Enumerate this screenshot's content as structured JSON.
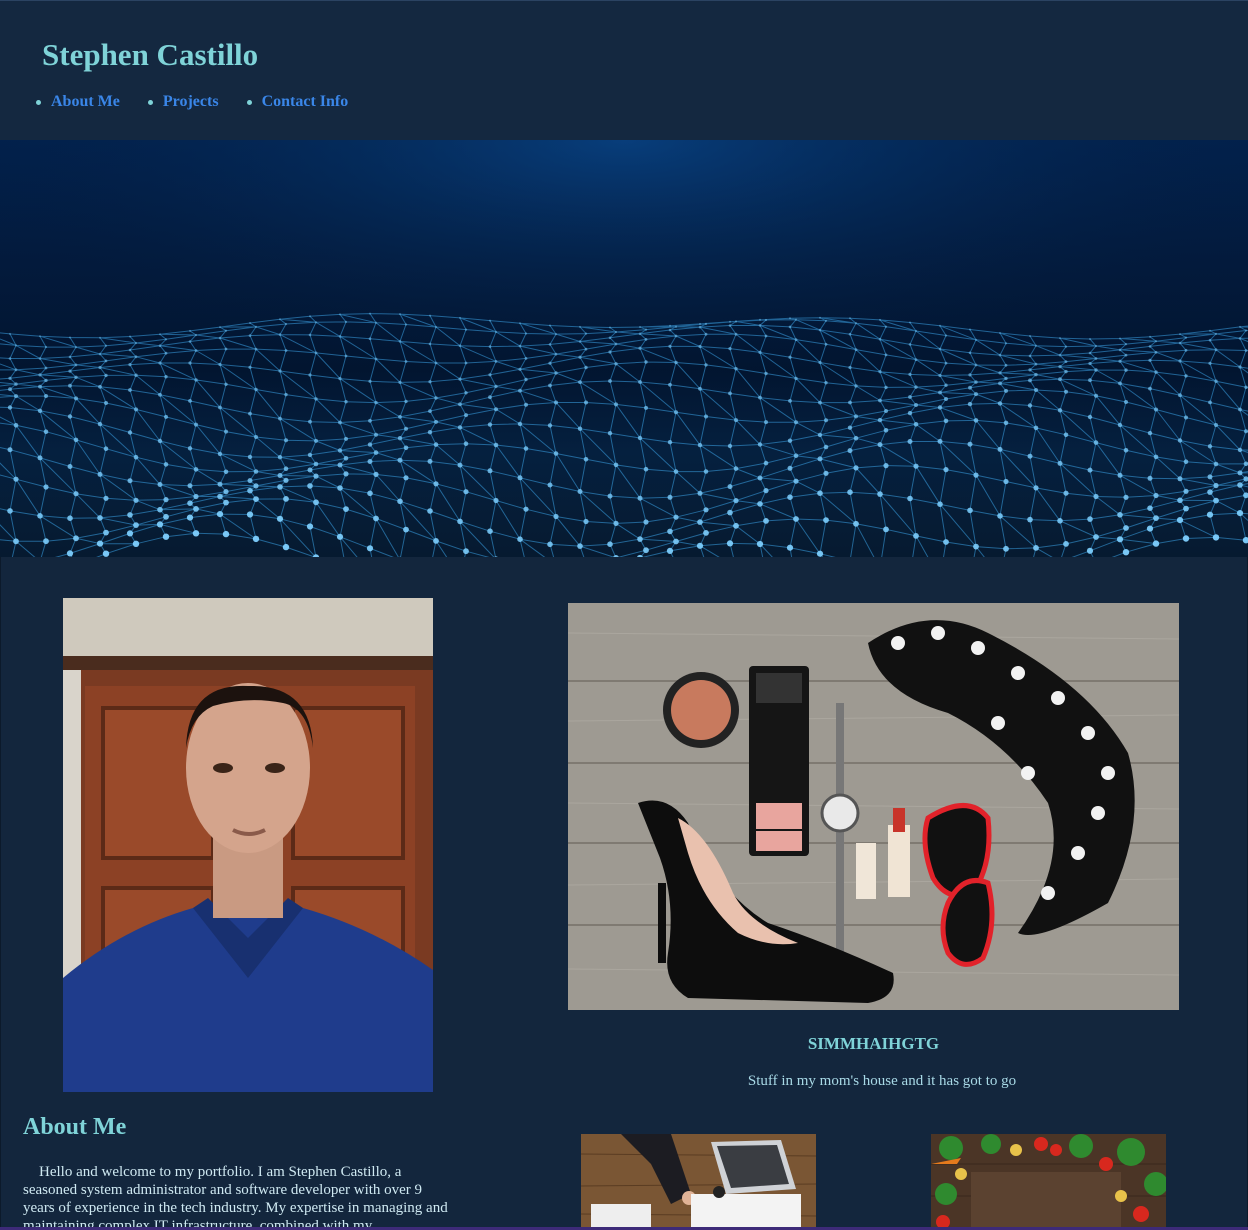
{
  "header": {
    "site_title": "Stephen Castillo",
    "nav": [
      {
        "label": "About Me"
      },
      {
        "label": "Projects"
      },
      {
        "label": "Contact Info"
      }
    ]
  },
  "about": {
    "heading": "About Me",
    "text": "Hello and welcome to my portfolio. I am Stephen Castillo, a seasoned system administrator and software developer with over 9 years of experience in the tech industry. My expertise in managing and maintaining complex IT infrastructure, combined with my"
  },
  "projects": {
    "featured": {
      "title": "SIMMHAIHGTG",
      "description": "Stuff in my mom's house and it has got to go"
    }
  },
  "colors": {
    "background": "#13263d",
    "header_background": "#142840",
    "heading_text": "#7fd3d8",
    "link": "#3a86e8"
  }
}
